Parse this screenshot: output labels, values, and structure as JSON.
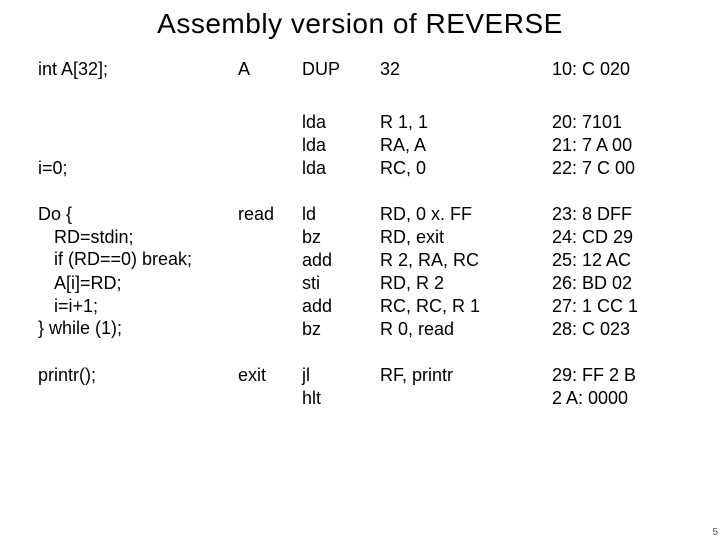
{
  "title": "Assembly version of REVERSE",
  "col1": {
    "a": "int A[32];",
    "b1": "i=0;",
    "b2": "Do {",
    "b3": "RD=stdin;",
    "b4": "if (RD==0) break;",
    "c1": "A[i]=RD;",
    "c2": "i=i+1;",
    "c3": "} while (1);",
    "d": "printr();"
  },
  "col2": {
    "r0": "A",
    "r4": "read",
    "r10": "exit"
  },
  "col3": {
    "r0": "DUP",
    "r1": "lda",
    "r2": "lda",
    "r3": "lda",
    "r4": "ld",
    "r5": "bz",
    "r6": "add",
    "r7": "sti",
    "r8": "add",
    "r9": "bz",
    "r10": "jl",
    "r11": "hlt"
  },
  "col4": {
    "r0": "32",
    "r1": "R 1, 1",
    "r2": "RA, A",
    "r3": "RC, 0",
    "r4": "RD, 0 x. FF",
    "r5": "RD, exit",
    "r6": "R 2, RA, RC",
    "r7": "RD, R 2",
    "r8": "RC, RC, R 1",
    "r9": "R 0, read",
    "r10": "RF, printr"
  },
  "col5": {
    "r0": "10: C 020",
    "r1": "20: 7101",
    "r2": "21: 7 A 00",
    "r3": "22: 7 C 00",
    "r4": "23: 8 DFF",
    "r5": "24: CD 29",
    "r6": "25: 12 AC",
    "r7": "26: BD 02",
    "r8": "27: 1 CC 1",
    "r9": "28: C 023",
    "r10": "29: FF 2 B",
    "r11": "2 A: 0000"
  },
  "corner": "5"
}
